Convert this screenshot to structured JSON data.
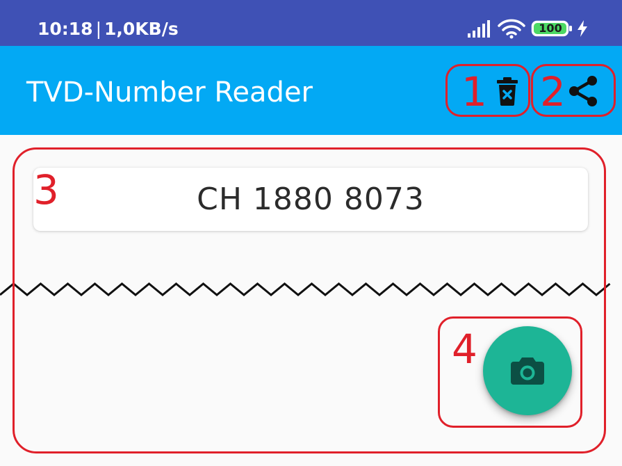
{
  "status_bar": {
    "time": "10:18",
    "separator": "|",
    "network_speed": "1,0KB/s",
    "battery_level": "100",
    "icons": [
      "signal-icon",
      "wifi-icon",
      "battery-icon",
      "charging-icon"
    ]
  },
  "app_bar": {
    "title": "TVD-Number Reader",
    "actions": [
      {
        "name": "delete",
        "icon": "delete-icon"
      },
      {
        "name": "share",
        "icon": "share-icon"
      }
    ]
  },
  "main": {
    "recognized_number": "CH 1880 8073",
    "fab_icon": "camera-icon"
  },
  "callouts": [
    "1",
    "2",
    "3",
    "4"
  ],
  "colors": {
    "status_bar": "#3f51b5",
    "app_bar": "#03a9f4",
    "background": "#fafafa",
    "fab": "#1db596",
    "fab_icon": "#0c4f44",
    "callout": "#e0202a"
  }
}
